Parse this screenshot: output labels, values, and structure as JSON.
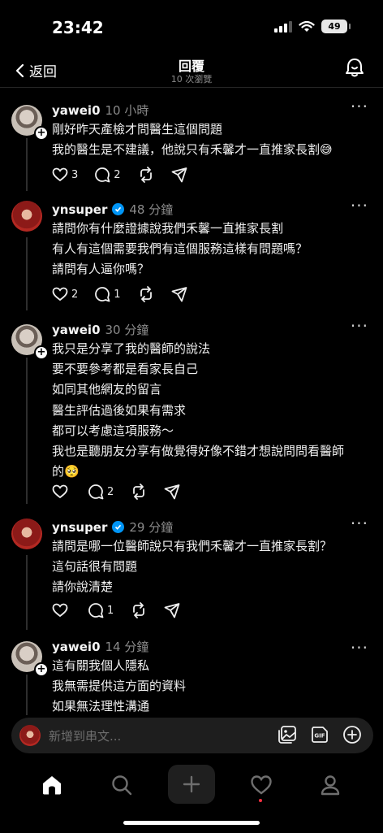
{
  "status_bar": {
    "time": "23:42",
    "battery": "49"
  },
  "header": {
    "back_label": "返回",
    "title": "回覆",
    "subtitle": "10 次瀏覽"
  },
  "posts": [
    {
      "username": "yawei0",
      "verified": false,
      "time": "10 小時",
      "lines": [
        "剛好昨天產檢才問醫生這個問題",
        "我的醫生是不建議，他說只有禾馨才一直推家長割😅"
      ],
      "likes": "3",
      "replies": "2"
    },
    {
      "username": "ynsuper",
      "verified": true,
      "time": "48 分鐘",
      "lines": [
        "請問你有什麼證據說我們禾馨一直推家長割",
        "有人有這個需要我們有這個服務這樣有問題嗎？",
        "請問有人逼你嗎？"
      ],
      "likes": "2",
      "replies": "1"
    },
    {
      "username": "yawei0",
      "verified": false,
      "time": "30 分鐘",
      "lines": [
        "我只是分享了我的醫師的說法",
        "要不要參考都是看家長自己",
        "如同其他網友的留言",
        "醫生評估過後如果有需求",
        "都可以考慮這項服務～",
        "我也是聽朋友分享有做覺得好像不錯才想說問問看醫師",
        "的🥺"
      ],
      "likes": "",
      "replies": "2"
    },
    {
      "username": "ynsuper",
      "verified": true,
      "time": "29 分鐘",
      "lines": [
        "請問是哪一位醫師說只有我們禾馨才一直推家長割？",
        "這句話很有問題",
        "請你說清楚"
      ],
      "likes": "",
      "replies": "1"
    },
    {
      "username": "yawei0",
      "verified": false,
      "time": "14 分鐘",
      "lines": [
        "這有關我個人隱私",
        "我無需提供這方面的資料",
        "如果無法理性溝通"
      ],
      "likes": "",
      "replies": ""
    }
  ],
  "composer": {
    "placeholder": "新增到串文..."
  },
  "colors": {
    "accent_verified": "#0095f6",
    "notification_dot": "#ff3040",
    "background": "#000000"
  }
}
